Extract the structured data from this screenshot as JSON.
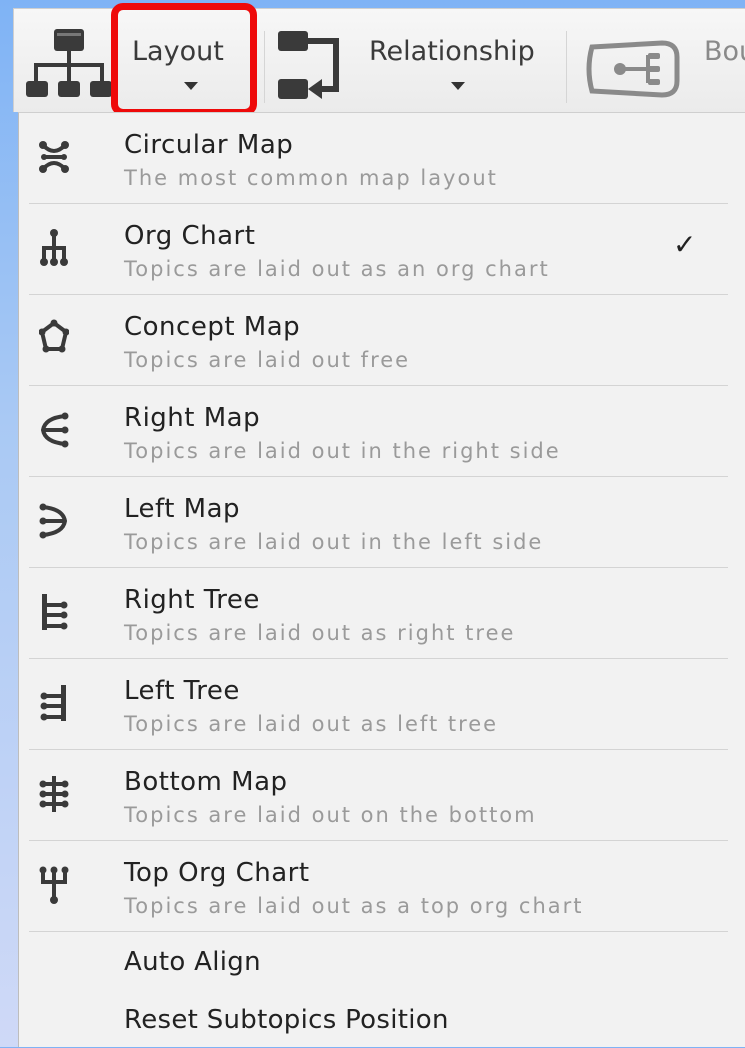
{
  "toolbar": {
    "layout_label": "Layout",
    "relationship_label": "Relationship",
    "boundary_label": "Bou"
  },
  "menu": {
    "items": [
      {
        "title": "Circular Map",
        "subtitle": "The most common map layout",
        "icon": "circular-map-icon",
        "checked": false
      },
      {
        "title": "Org Chart",
        "subtitle": "Topics are laid out as an org chart",
        "icon": "org-chart-icon",
        "checked": true,
        "check_mark": "✓"
      },
      {
        "title": "Concept Map",
        "subtitle": "Topics are laid out free",
        "icon": "concept-map-icon",
        "checked": false
      },
      {
        "title": "Right Map",
        "subtitle": "Topics are laid out in the right side",
        "icon": "right-map-icon",
        "checked": false
      },
      {
        "title": "Left Map",
        "subtitle": "Topics are laid out in the left side",
        "icon": "left-map-icon",
        "checked": false
      },
      {
        "title": "Right Tree",
        "subtitle": "Topics are laid out as right tree",
        "icon": "right-tree-icon",
        "checked": false
      },
      {
        "title": "Left Tree",
        "subtitle": "Topics are laid out as left tree",
        "icon": "left-tree-icon",
        "checked": false
      },
      {
        "title": "Bottom Map",
        "subtitle": "Topics are laid out on the bottom",
        "icon": "bottom-map-icon",
        "checked": false
      },
      {
        "title": "Top Org Chart",
        "subtitle": "Topics are laid out as a top org chart",
        "icon": "top-org-chart-icon",
        "checked": false
      }
    ],
    "auto_align": "Auto Align",
    "reset_subtopics": "Reset Subtopics Position"
  },
  "colors": {
    "highlight": "#ee0a0a",
    "icon": "#3a3a3a",
    "menu_bg": "#f2f2f2",
    "subtitle": "#9a9a9a"
  }
}
